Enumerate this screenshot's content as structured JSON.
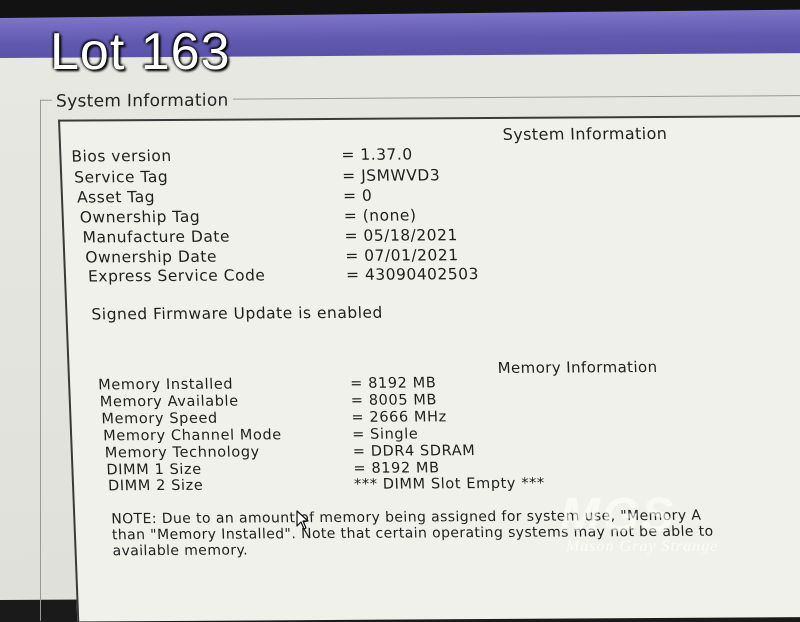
{
  "overlay": {
    "lot_label": "Lot 163"
  },
  "group": {
    "label": "System Information"
  },
  "system": {
    "heading": "System Information",
    "rows": [
      {
        "label": "Bios version",
        "value": "= 1.37.0"
      },
      {
        "label": "Service Tag",
        "value": "= JSMWVD3"
      },
      {
        "label": "Asset Tag",
        "value": "= 0"
      },
      {
        "label": "Ownership Tag",
        "value": "= (none)"
      },
      {
        "label": "Manufacture Date",
        "value": "= 05/18/2021"
      },
      {
        "label": "Ownership Date",
        "value": "= 07/01/2021"
      },
      {
        "label": "Express Service Code",
        "value": "= 43090402503"
      }
    ],
    "signed_firmware": "Signed Firmware Update is enabled"
  },
  "memory": {
    "heading": "Memory Information",
    "rows": [
      {
        "label": "Memory Installed",
        "value": "= 8192 MB"
      },
      {
        "label": "Memory Available",
        "value": "= 8005 MB"
      },
      {
        "label": "Memory Speed",
        "value": "= 2666 MHz"
      },
      {
        "label": "Memory Channel Mode",
        "value": "= Single"
      },
      {
        "label": "Memory Technology",
        "value": "= DDR4 SDRAM"
      },
      {
        "label": "DIMM 1 Size",
        "value": "= 8192 MB"
      },
      {
        "label": "DIMM 2 Size",
        "value": "*** DIMM Slot Empty ***"
      }
    ],
    "note_lines": [
      "NOTE: Due to an amount of memory being assigned for system use, \"Memory A",
      "than \"Memory Installed\". Note that certain operating systems may not be able to",
      "available memory."
    ]
  },
  "watermark": {
    "logo": "MGS",
    "subtitle": "Mason Gray Strange"
  },
  "icons": {
    "cursor": "mouse-pointer-icon"
  }
}
